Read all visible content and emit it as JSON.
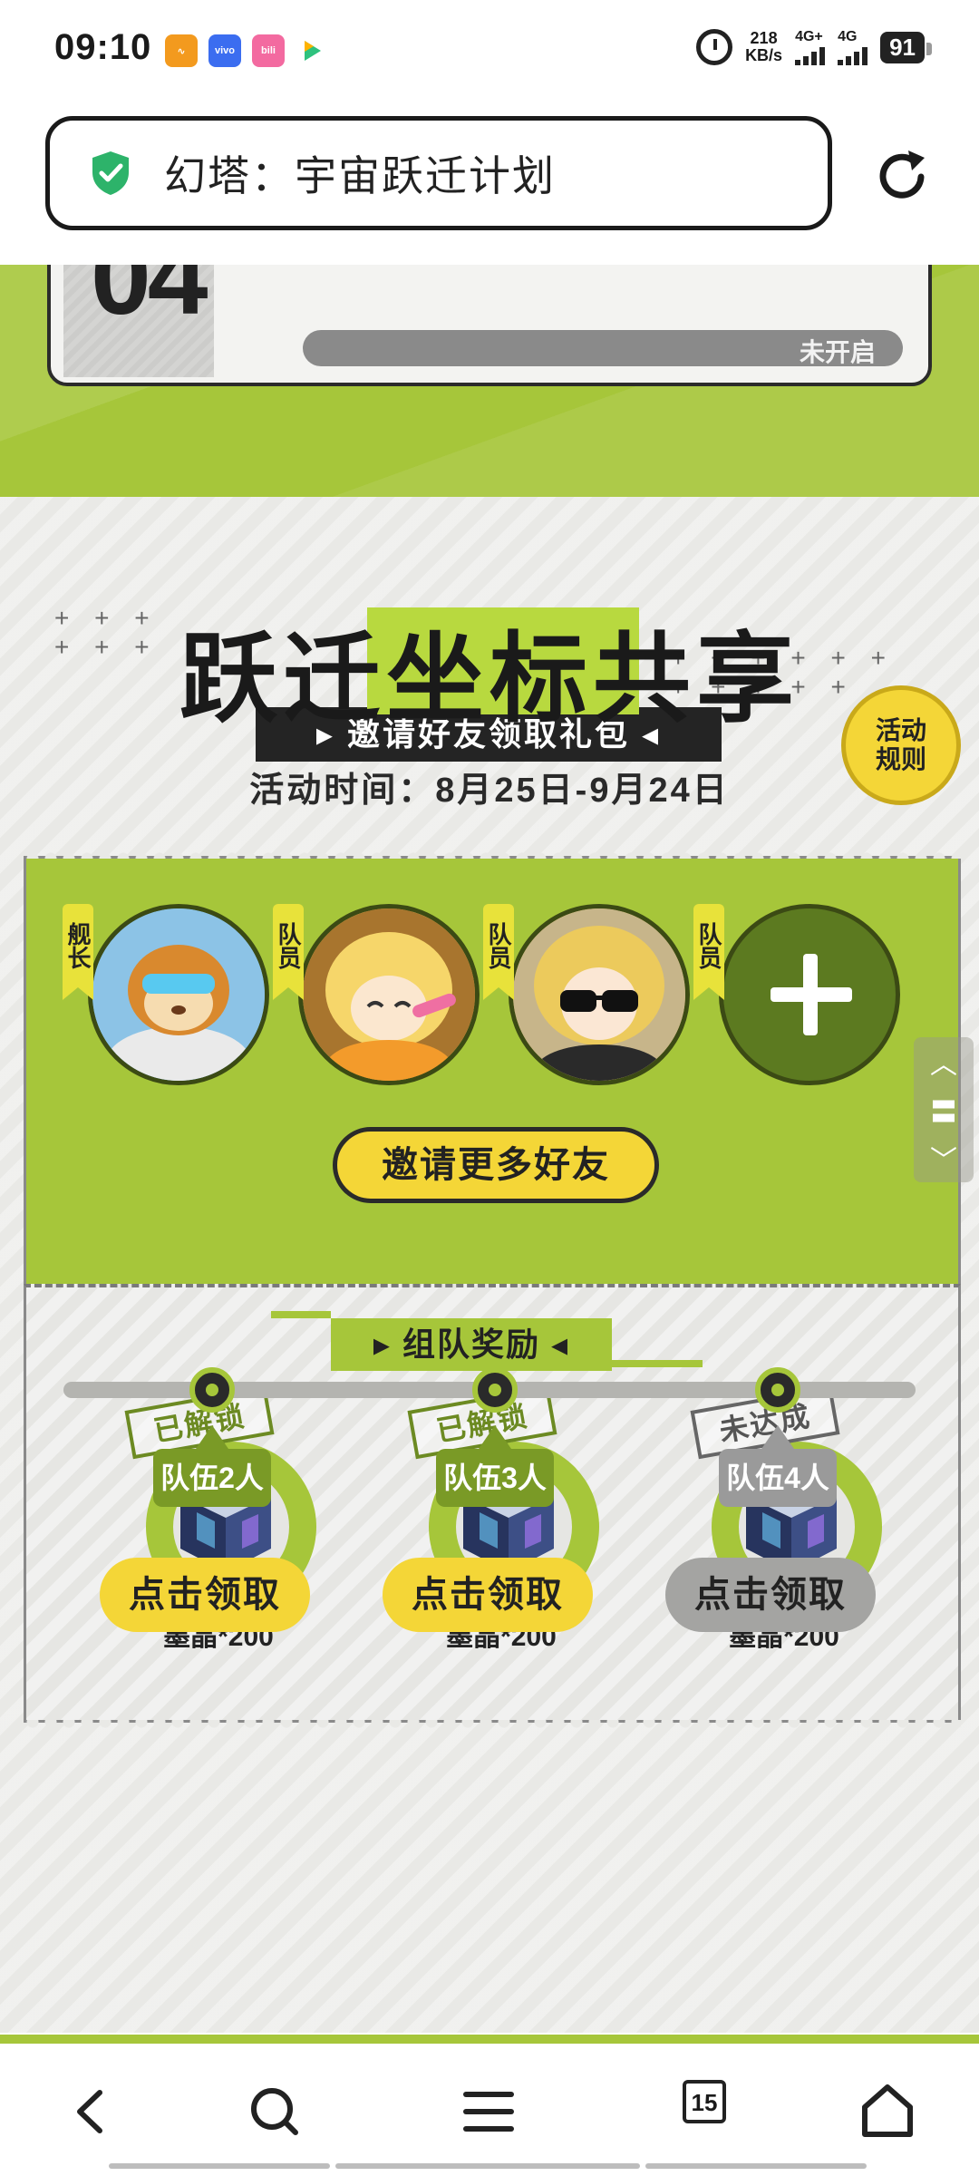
{
  "status_bar": {
    "time": "09:10",
    "app_icons": [
      "app-icon-orange",
      "vivo",
      "bilibili",
      "video-app"
    ],
    "vivo_label": "vivo",
    "bilibili_label": "bili",
    "net_speed_value": "218",
    "net_speed_unit": "KB/s",
    "signal1": "4G+",
    "signal2": "4G",
    "battery": "91"
  },
  "address_bar": {
    "title": "幻塔：宇宙跃迁计划"
  },
  "step_card": {
    "number": "04",
    "status": "未开启"
  },
  "event": {
    "title": "跃迁坐标共享",
    "subtitle": "▸ 邀请好友领取礼包 ◂",
    "time": "活动时间：8月25日-9月24日",
    "rules_label_line1": "活动",
    "rules_label_line2": "规则"
  },
  "team": {
    "members": [
      {
        "tag": "舰长"
      },
      {
        "tag": "队员"
      },
      {
        "tag": "队员"
      },
      {
        "tag": "队员"
      }
    ],
    "invite_label": "邀请更多好友"
  },
  "scroll": {
    "up": "︿",
    "mid": "〓",
    "down": "﹀"
  },
  "rewards": {
    "header": "▸ 组队奖励 ◂",
    "items": [
      {
        "stamp": "已解锁",
        "label": "墨晶*200",
        "team_size": "队伍2人",
        "claim": "点击领取"
      },
      {
        "stamp": "已解锁",
        "label": "墨晶*200",
        "team_size": "队伍3人",
        "claim": "点击领取"
      },
      {
        "stamp": "未达成",
        "label": "墨晶*200",
        "team_size": "队伍4人",
        "claim": "点击领取"
      }
    ]
  },
  "bottom_nav": {
    "tab_count": "15"
  },
  "colors": {
    "accent_green": "#a6c63a",
    "accent_yellow": "#f4d637",
    "shield_green": "#2db36a"
  }
}
